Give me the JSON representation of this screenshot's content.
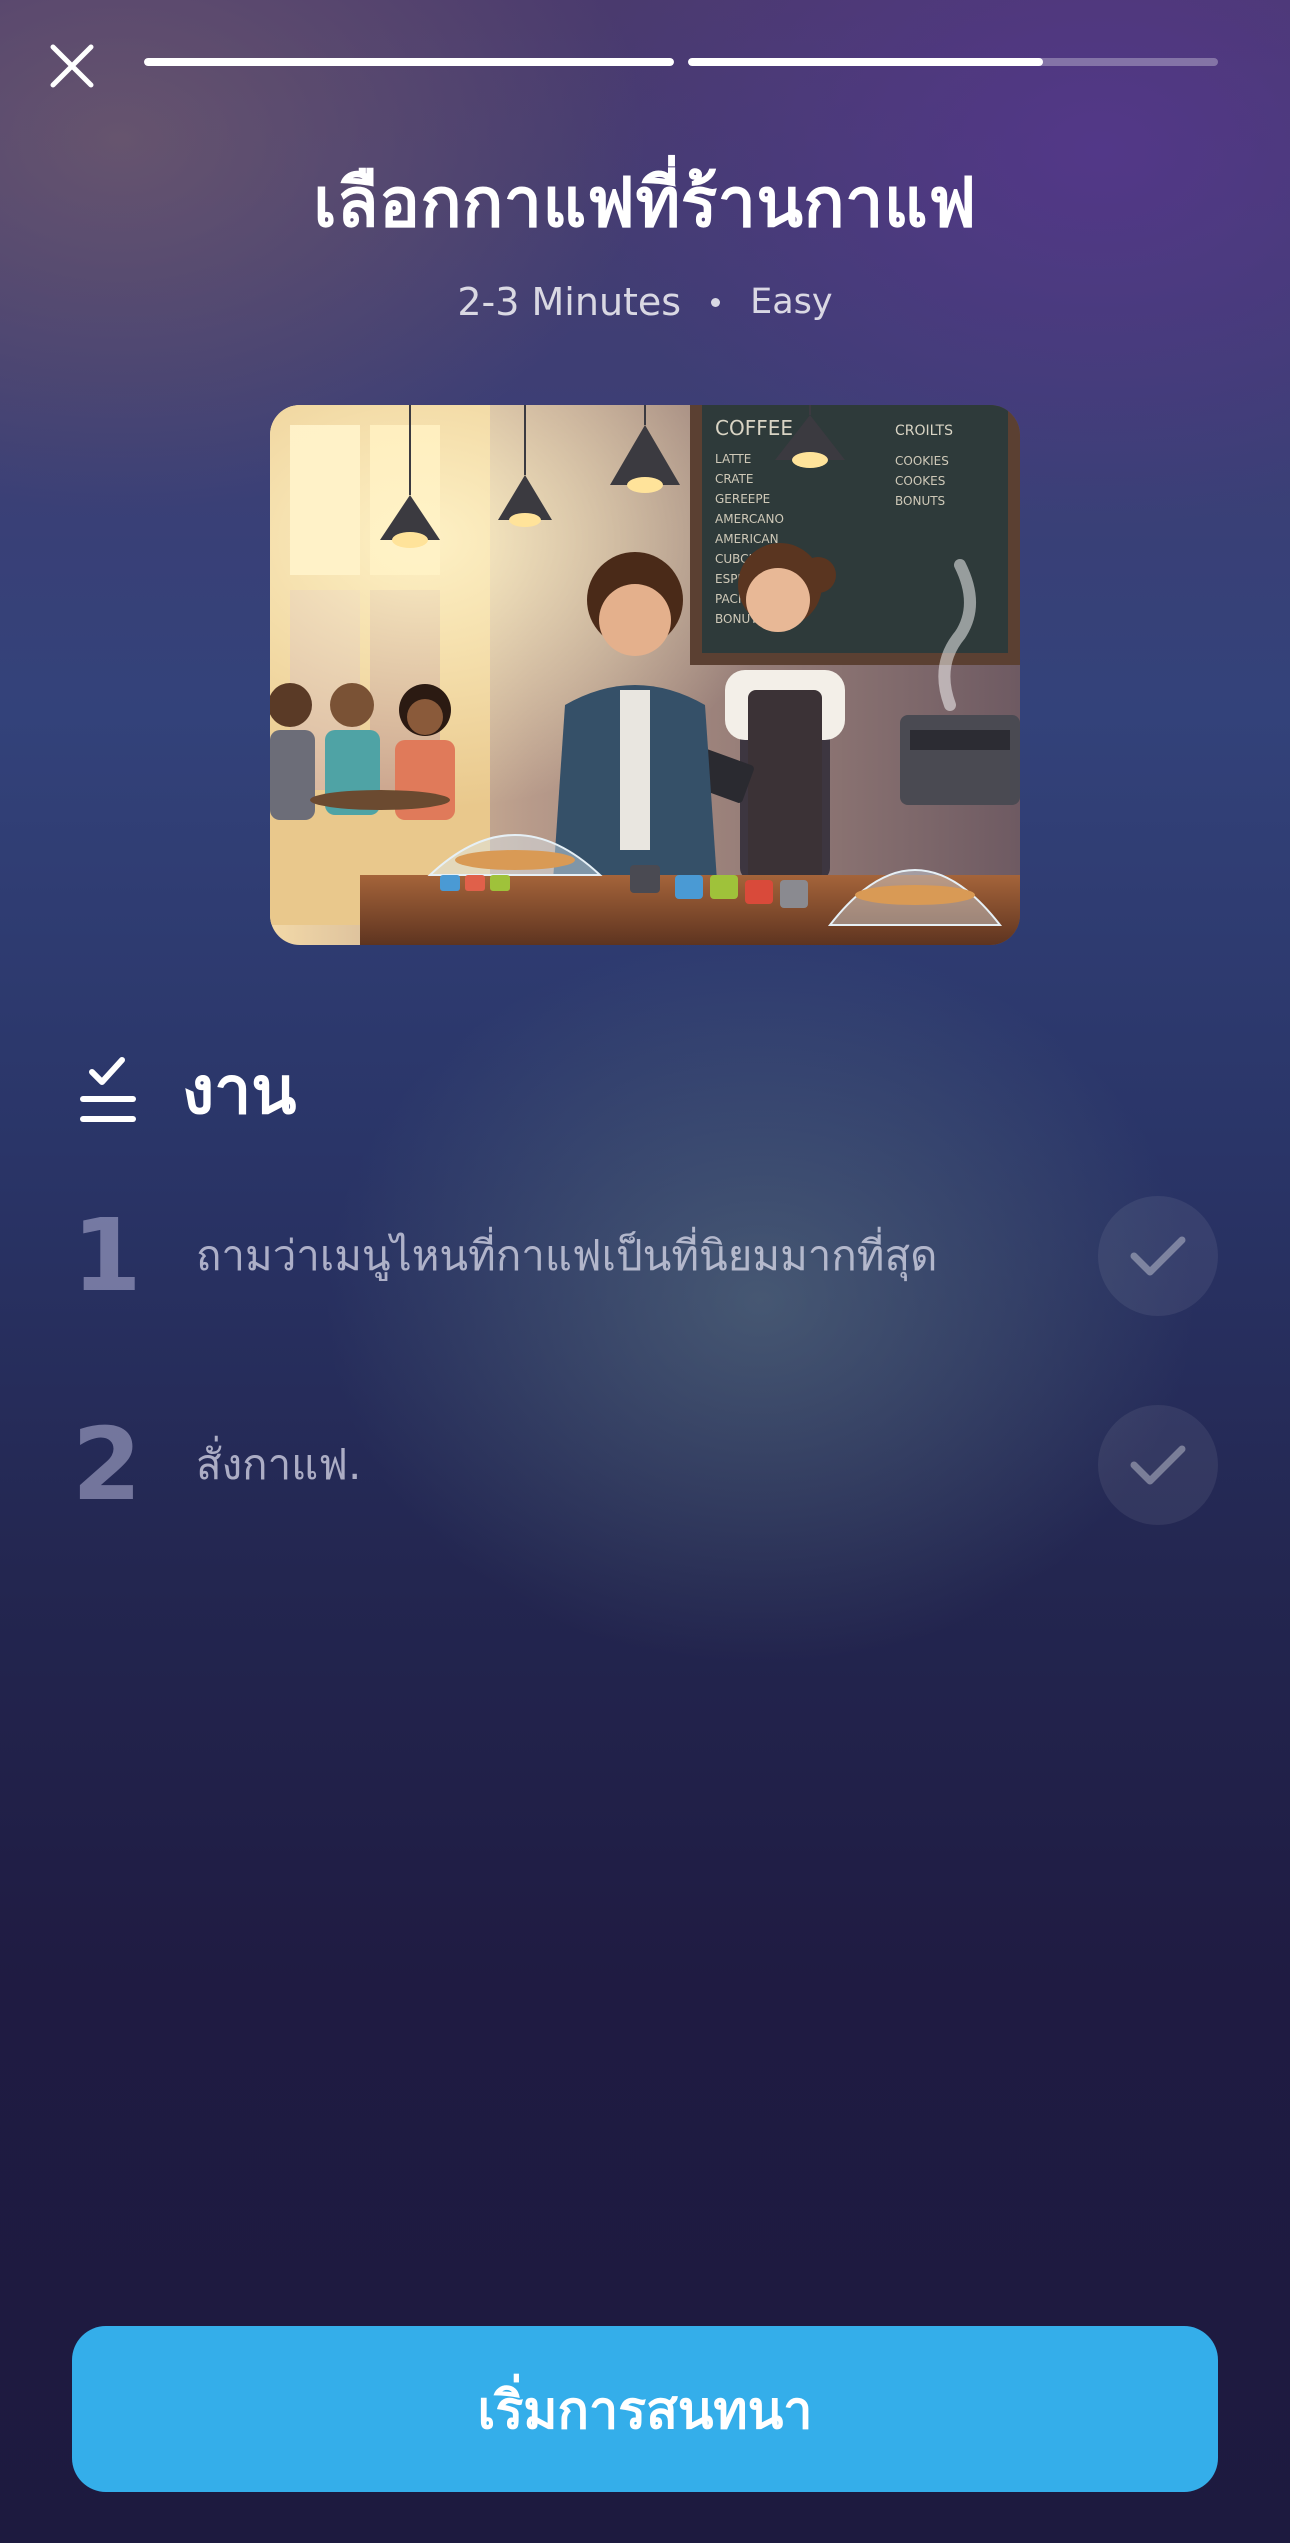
{
  "header": {
    "title": "เลือกกาแฟที่ร้านกาแฟ",
    "duration": "2-3 Minutes",
    "difficulty": "Easy"
  },
  "progress": {
    "segments": [
      1.0,
      0.67
    ]
  },
  "icons": {
    "close": "close-icon",
    "tasks": "checklist-icon",
    "check": "check-icon"
  },
  "scene": {
    "menu_board": {
      "left_title": "COFFEE",
      "left_items": [
        "LATTE",
        "CRATE",
        "GEREEPE",
        "AMERCANO",
        "AMERICAN",
        "CUBCHI",
        "ESPRESSO",
        "PACHA",
        "BONUTS"
      ],
      "right_title": "CROILTS",
      "right_items": [
        "COOKIES",
        "COOKES",
        "BONUTS"
      ]
    }
  },
  "tasks": {
    "title": "งาน",
    "items": [
      {
        "number": "1",
        "text": "ถามว่าเมนูไหนที่กาแฟเป็นที่นิยมมากที่สุด"
      },
      {
        "number": "2",
        "text": "สั่งกาแฟ."
      }
    ]
  },
  "cta": {
    "label": "เริ่มการสนทนา"
  },
  "colors": {
    "accent": "#34aeea",
    "background_top": "#4a3a6e",
    "background_bottom": "#1d1a3f"
  }
}
